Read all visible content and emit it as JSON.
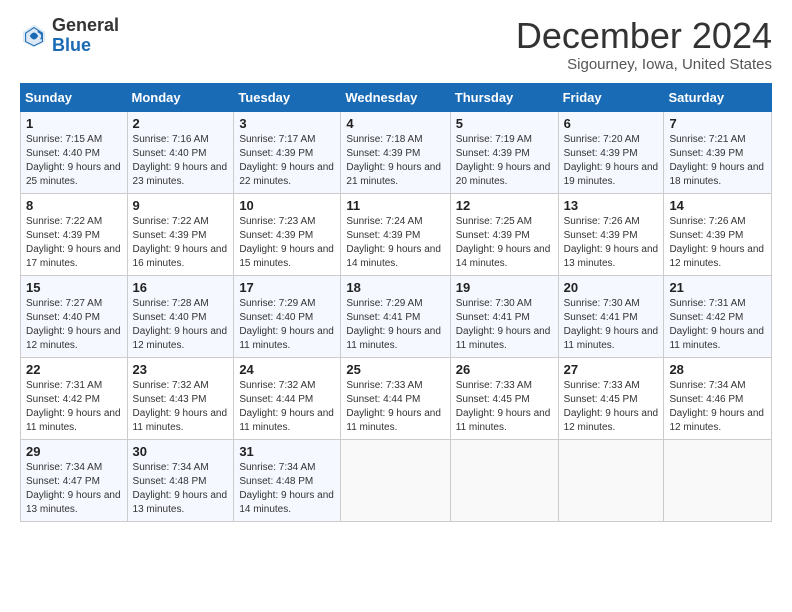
{
  "logo": {
    "line1": "General",
    "line2": "Blue"
  },
  "title": "December 2024",
  "subtitle": "Sigourney, Iowa, United States",
  "weekdays": [
    "Sunday",
    "Monday",
    "Tuesday",
    "Wednesday",
    "Thursday",
    "Friday",
    "Saturday"
  ],
  "weeks": [
    [
      {
        "day": "1",
        "sunrise": "7:15 AM",
        "sunset": "4:40 PM",
        "daylight": "9 hours and 25 minutes."
      },
      {
        "day": "2",
        "sunrise": "7:16 AM",
        "sunset": "4:40 PM",
        "daylight": "9 hours and 23 minutes."
      },
      {
        "day": "3",
        "sunrise": "7:17 AM",
        "sunset": "4:39 PM",
        "daylight": "9 hours and 22 minutes."
      },
      {
        "day": "4",
        "sunrise": "7:18 AM",
        "sunset": "4:39 PM",
        "daylight": "9 hours and 21 minutes."
      },
      {
        "day": "5",
        "sunrise": "7:19 AM",
        "sunset": "4:39 PM",
        "daylight": "9 hours and 20 minutes."
      },
      {
        "day": "6",
        "sunrise": "7:20 AM",
        "sunset": "4:39 PM",
        "daylight": "9 hours and 19 minutes."
      },
      {
        "day": "7",
        "sunrise": "7:21 AM",
        "sunset": "4:39 PM",
        "daylight": "9 hours and 18 minutes."
      }
    ],
    [
      {
        "day": "8",
        "sunrise": "7:22 AM",
        "sunset": "4:39 PM",
        "daylight": "9 hours and 17 minutes."
      },
      {
        "day": "9",
        "sunrise": "7:22 AM",
        "sunset": "4:39 PM",
        "daylight": "9 hours and 16 minutes."
      },
      {
        "day": "10",
        "sunrise": "7:23 AM",
        "sunset": "4:39 PM",
        "daylight": "9 hours and 15 minutes."
      },
      {
        "day": "11",
        "sunrise": "7:24 AM",
        "sunset": "4:39 PM",
        "daylight": "9 hours and 14 minutes."
      },
      {
        "day": "12",
        "sunrise": "7:25 AM",
        "sunset": "4:39 PM",
        "daylight": "9 hours and 14 minutes."
      },
      {
        "day": "13",
        "sunrise": "7:26 AM",
        "sunset": "4:39 PM",
        "daylight": "9 hours and 13 minutes."
      },
      {
        "day": "14",
        "sunrise": "7:26 AM",
        "sunset": "4:39 PM",
        "daylight": "9 hours and 12 minutes."
      }
    ],
    [
      {
        "day": "15",
        "sunrise": "7:27 AM",
        "sunset": "4:40 PM",
        "daylight": "9 hours and 12 minutes."
      },
      {
        "day": "16",
        "sunrise": "7:28 AM",
        "sunset": "4:40 PM",
        "daylight": "9 hours and 12 minutes."
      },
      {
        "day": "17",
        "sunrise": "7:29 AM",
        "sunset": "4:40 PM",
        "daylight": "9 hours and 11 minutes."
      },
      {
        "day": "18",
        "sunrise": "7:29 AM",
        "sunset": "4:41 PM",
        "daylight": "9 hours and 11 minutes."
      },
      {
        "day": "19",
        "sunrise": "7:30 AM",
        "sunset": "4:41 PM",
        "daylight": "9 hours and 11 minutes."
      },
      {
        "day": "20",
        "sunrise": "7:30 AM",
        "sunset": "4:41 PM",
        "daylight": "9 hours and 11 minutes."
      },
      {
        "day": "21",
        "sunrise": "7:31 AM",
        "sunset": "4:42 PM",
        "daylight": "9 hours and 11 minutes."
      }
    ],
    [
      {
        "day": "22",
        "sunrise": "7:31 AM",
        "sunset": "4:42 PM",
        "daylight": "9 hours and 11 minutes."
      },
      {
        "day": "23",
        "sunrise": "7:32 AM",
        "sunset": "4:43 PM",
        "daylight": "9 hours and 11 minutes."
      },
      {
        "day": "24",
        "sunrise": "7:32 AM",
        "sunset": "4:44 PM",
        "daylight": "9 hours and 11 minutes."
      },
      {
        "day": "25",
        "sunrise": "7:33 AM",
        "sunset": "4:44 PM",
        "daylight": "9 hours and 11 minutes."
      },
      {
        "day": "26",
        "sunrise": "7:33 AM",
        "sunset": "4:45 PM",
        "daylight": "9 hours and 11 minutes."
      },
      {
        "day": "27",
        "sunrise": "7:33 AM",
        "sunset": "4:45 PM",
        "daylight": "9 hours and 12 minutes."
      },
      {
        "day": "28",
        "sunrise": "7:34 AM",
        "sunset": "4:46 PM",
        "daylight": "9 hours and 12 minutes."
      }
    ],
    [
      {
        "day": "29",
        "sunrise": "7:34 AM",
        "sunset": "4:47 PM",
        "daylight": "9 hours and 13 minutes."
      },
      {
        "day": "30",
        "sunrise": "7:34 AM",
        "sunset": "4:48 PM",
        "daylight": "9 hours and 13 minutes."
      },
      {
        "day": "31",
        "sunrise": "7:34 AM",
        "sunset": "4:48 PM",
        "daylight": "9 hours and 14 minutes."
      },
      null,
      null,
      null,
      null
    ]
  ]
}
